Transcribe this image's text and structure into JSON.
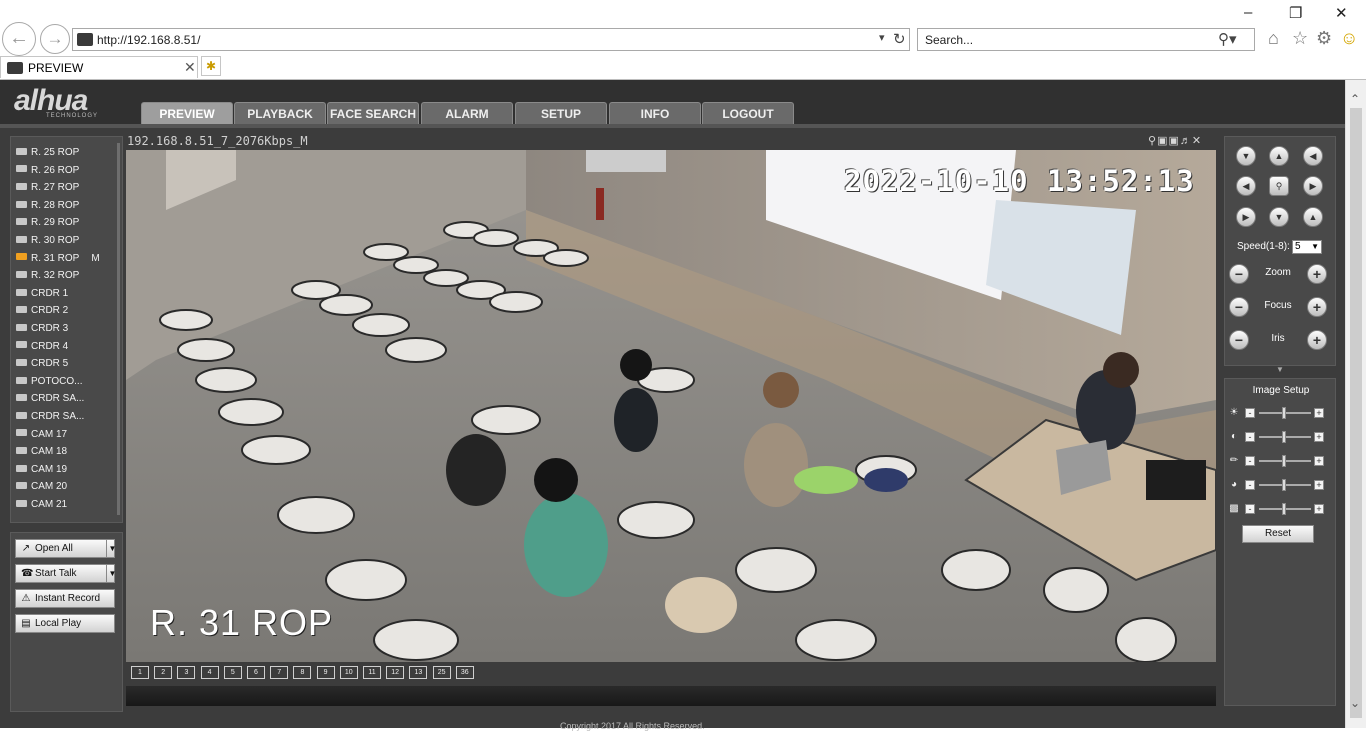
{
  "browser": {
    "url": "http://192.168.8.51/",
    "search_placeholder": "Search...",
    "tab_title": "PREVIEW"
  },
  "app": {
    "logo": "alhua",
    "logo_sub": "TECHNOLOGY",
    "nav": [
      "PREVIEW",
      "PLAYBACK",
      "FACE SEARCH",
      "ALARM",
      "SETUP",
      "INFO",
      "LOGOUT"
    ],
    "active_nav": "PREVIEW"
  },
  "channels": [
    {
      "label": "R. 25 ROP",
      "marker": ""
    },
    {
      "label": "R. 26 ROP",
      "marker": ""
    },
    {
      "label": "R. 27 ROP",
      "marker": ""
    },
    {
      "label": "R. 28 ROP",
      "marker": ""
    },
    {
      "label": "R. 29 ROP",
      "marker": ""
    },
    {
      "label": "R. 30 ROP",
      "marker": ""
    },
    {
      "label": "R. 31 ROP",
      "marker": "M"
    },
    {
      "label": "R. 32 ROP",
      "marker": ""
    },
    {
      "label": "CRDR 1",
      "marker": ""
    },
    {
      "label": "CRDR 2",
      "marker": ""
    },
    {
      "label": "CRDR 3",
      "marker": ""
    },
    {
      "label": "CRDR 4",
      "marker": ""
    },
    {
      "label": "CRDR 5",
      "marker": ""
    },
    {
      "label": "POTOCO...",
      "marker": ""
    },
    {
      "label": "CRDR SA...",
      "marker": ""
    },
    {
      "label": "CRDR SA...",
      "marker": ""
    },
    {
      "label": "CAM 17",
      "marker": ""
    },
    {
      "label": "CAM 18",
      "marker": ""
    },
    {
      "label": "CAM 19",
      "marker": ""
    },
    {
      "label": "CAM 20",
      "marker": ""
    },
    {
      "label": "CAM 21",
      "marker": ""
    }
  ],
  "active_channel": "R. 31 ROP",
  "actions": {
    "open_all": "Open All",
    "start_talk": "Start Talk",
    "instant_record": "Instant Record",
    "local_play": "Local Play"
  },
  "video": {
    "stream_title": "192.168.8.51_7_2076Kbps_M",
    "osd_datetime": "2022-10-10 13:52:13",
    "osd_name": "R. 31 ROP"
  },
  "layouts": [
    "1",
    "2",
    "3",
    "4",
    "5",
    "6",
    "7",
    "8",
    "9",
    "10",
    "11",
    "12",
    "13",
    "25",
    "36"
  ],
  "ptz": {
    "speed_label": "Speed(1-8):",
    "speed_value": "5",
    "zoom_label": "Zoom",
    "focus_label": "Focus",
    "iris_label": "Iris"
  },
  "image_setup": {
    "title": "Image Setup",
    "rows": [
      "brightness",
      "contrast",
      "saturation",
      "hue",
      "gain"
    ],
    "reset_label": "Reset"
  },
  "footer": "Copyright 2017 All Rights Reserved."
}
